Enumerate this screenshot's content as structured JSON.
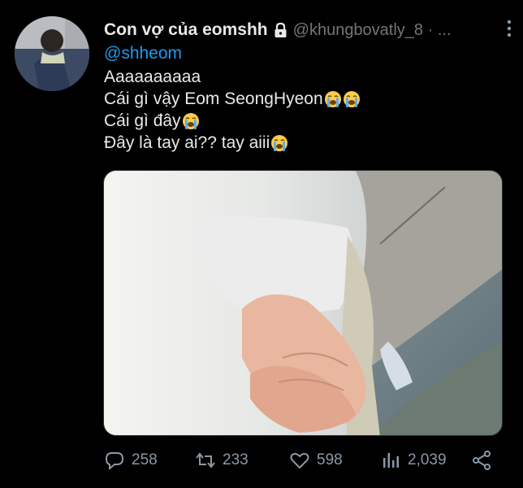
{
  "tweet": {
    "author": {
      "display_name": "Con vợ của eomshh",
      "handle": "@khungbovatly_8 · ..."
    },
    "reply_to": "@shheom",
    "lines": [
      "Aaaaaaaaaa",
      "Cái gì vậy Eom SeongHyeon",
      "Cái gì đây",
      "Đây là tay ai?? tay aiii"
    ],
    "emoji_icon": "loudly-crying-face"
  },
  "actions": {
    "reply_count": "258",
    "retweet_count": "233",
    "like_count": "598",
    "views_count": "2,039"
  },
  "colors": {
    "background": "#000000",
    "text": "#e7e9ea",
    "secondary": "#71767b",
    "link": "#1d9bf0"
  }
}
